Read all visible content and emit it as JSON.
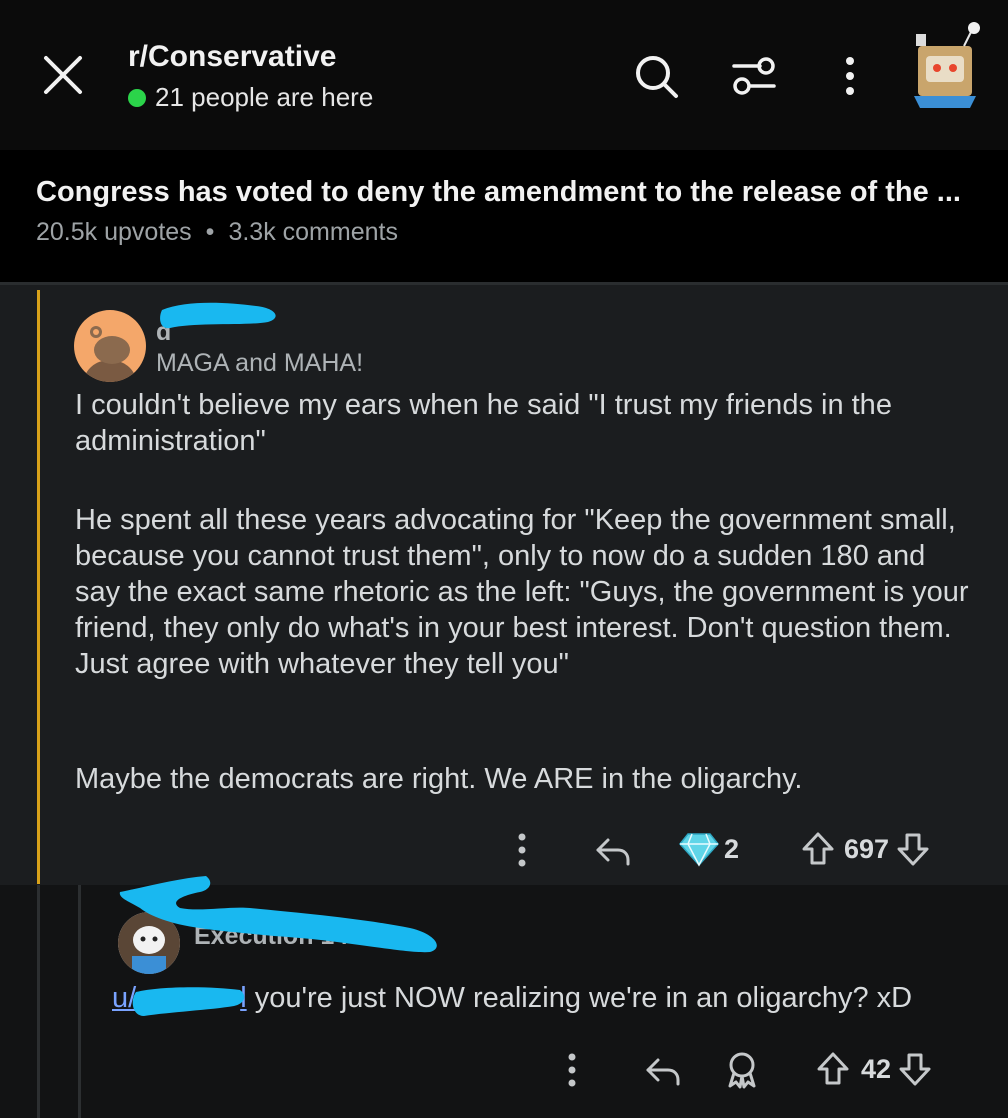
{
  "header": {
    "subreddit": "r/Conservative",
    "online_text": "21 people are here",
    "icons": [
      "close-icon",
      "search-icon",
      "filter-icon",
      "more-vertical-icon",
      "user-avatar"
    ]
  },
  "post": {
    "title": "Congress has voted to deny the amendment to the release of the ...",
    "upvotes": "20.5k upvotes",
    "separator": "•",
    "comments": "3.3k comments"
  },
  "comment1": {
    "username_visible": "d",
    "flair": "MAGA and MAHA!",
    "paragraphs": [
      "I couldn't believe my ears when he said \"I trust my friends in the administration\"",
      "He spent all these years advocating for \"Keep the government small, because you cannot trust them\", only to now do a sudden 180 and say the exact same rhetoric as the left: \"Guys, the government is your friend, they only do what's in your best interest. Don't question them. Just agree with whatever they tell you\"",
      "Maybe the democrats are right. We ARE in the oligarchy."
    ],
    "award_count": "2",
    "vote_count": "697"
  },
  "comment2": {
    "username_fragment": "Execution 14",
    "mention_prefix": "u/",
    "mention_suffix": "l",
    "text": " you're just NOW realizing we're in an oligarchy? xD",
    "vote_count": "42"
  },
  "colors": {
    "background": "#000000",
    "comment_bg": "#1b1d1f",
    "thread_gold": "#d9a21a",
    "online_green": "#2bd44a",
    "link_blue": "#7aa3ff",
    "redaction_cyan": "#19b8f0"
  }
}
